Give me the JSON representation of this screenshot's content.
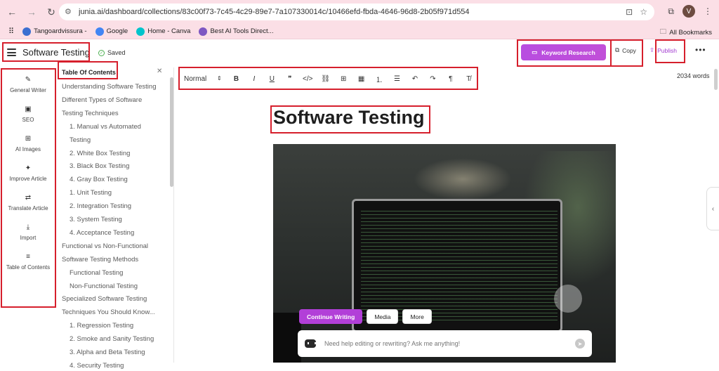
{
  "browser": {
    "url": "junia.ai/dashboard/collections/83c00f73-7c45-4c29-89e7-7a107330014c/10466efd-fbda-4646-96d8-2b05f971d554",
    "avatar_letter": "V",
    "bookmarks": [
      {
        "label": "Tangoardvissura -",
        "color": "#3b6fd1"
      },
      {
        "label": "Google",
        "color": "#4285f4"
      },
      {
        "label": "Home - Canva",
        "color": "#00c4cc"
      },
      {
        "label": "Best AI Tools Direct...",
        "color": "#7e57c2"
      }
    ],
    "all_bookmarks": "All Bookmarks"
  },
  "header": {
    "doc_title": "Software Testing",
    "saved": "Saved",
    "keyword_research": "Keyword Research",
    "copy": "Copy",
    "publish": "Publish"
  },
  "sidebar": {
    "items": [
      {
        "label": "General Writer",
        "icon": "✎"
      },
      {
        "label": "SEO",
        "icon": "▣"
      },
      {
        "label": "AI Images",
        "icon": "⊞"
      },
      {
        "label": "Improve Article",
        "icon": "✦"
      },
      {
        "label": "Translate Article",
        "icon": "⇄"
      },
      {
        "label": "Import",
        "icon": "⤓"
      },
      {
        "label": "Table of Contents",
        "icon": "≡"
      }
    ]
  },
  "toc": {
    "title": "Table Of Contents",
    "items": [
      {
        "label": "Understanding Software Testing",
        "indent": 0
      },
      {
        "label": "Different Types of Software",
        "indent": 0
      },
      {
        "label": "Testing Techniques",
        "indent": 0
      },
      {
        "label": "1. Manual vs Automated",
        "indent": 1
      },
      {
        "label": "Testing",
        "indent": 1
      },
      {
        "label": "2. White Box Testing",
        "indent": 1
      },
      {
        "label": "3. Black Box Testing",
        "indent": 1
      },
      {
        "label": "4. Gray Box Testing",
        "indent": 1
      },
      {
        "label": "1. Unit Testing",
        "indent": 1
      },
      {
        "label": "2. Integration Testing",
        "indent": 1
      },
      {
        "label": "3. System Testing",
        "indent": 1
      },
      {
        "label": "4. Acceptance Testing",
        "indent": 1
      },
      {
        "label": "Functional vs Non-Functional",
        "indent": 0
      },
      {
        "label": "Software Testing Methods",
        "indent": 0
      },
      {
        "label": "Functional Testing",
        "indent": 1
      },
      {
        "label": "Non-Functional Testing",
        "indent": 1
      },
      {
        "label": "Specialized Software Testing",
        "indent": 0
      },
      {
        "label": "Techniques You Should Know...",
        "indent": 0
      },
      {
        "label": "1. Regression Testing",
        "indent": 1
      },
      {
        "label": "2. Smoke and Sanity Testing",
        "indent": 1
      },
      {
        "label": "3. Alpha and Beta Testing",
        "indent": 1
      },
      {
        "label": "4. Security Testing",
        "indent": 1
      }
    ]
  },
  "toolbar": {
    "format": "Normal",
    "buttons": [
      {
        "name": "bold-button",
        "glyph": "B"
      },
      {
        "name": "italic-button",
        "glyph": "I"
      },
      {
        "name": "underline-button",
        "glyph": "U"
      },
      {
        "name": "quote-button",
        "glyph": "❞"
      },
      {
        "name": "code-button",
        "glyph": "</>"
      },
      {
        "name": "link-button",
        "glyph": "⛓"
      },
      {
        "name": "image-button",
        "glyph": "⊞"
      },
      {
        "name": "table-button",
        "glyph": "▦"
      },
      {
        "name": "ordered-list-button",
        "glyph": "⒈"
      },
      {
        "name": "bullet-list-button",
        "glyph": "☰"
      },
      {
        "name": "undo-button",
        "glyph": "↶"
      },
      {
        "name": "redo-button",
        "glyph": "↷"
      },
      {
        "name": "paragraph-button",
        "glyph": "¶"
      },
      {
        "name": "clear-format-button",
        "glyph": "T̸"
      }
    ],
    "wordcount": "2034 words"
  },
  "editor": {
    "heading": "Software Testing"
  },
  "ai": {
    "tabs": [
      "Continue Writing",
      "Media",
      "More"
    ],
    "placeholder": "Need help editing or rewriting? Ask me anything!"
  }
}
